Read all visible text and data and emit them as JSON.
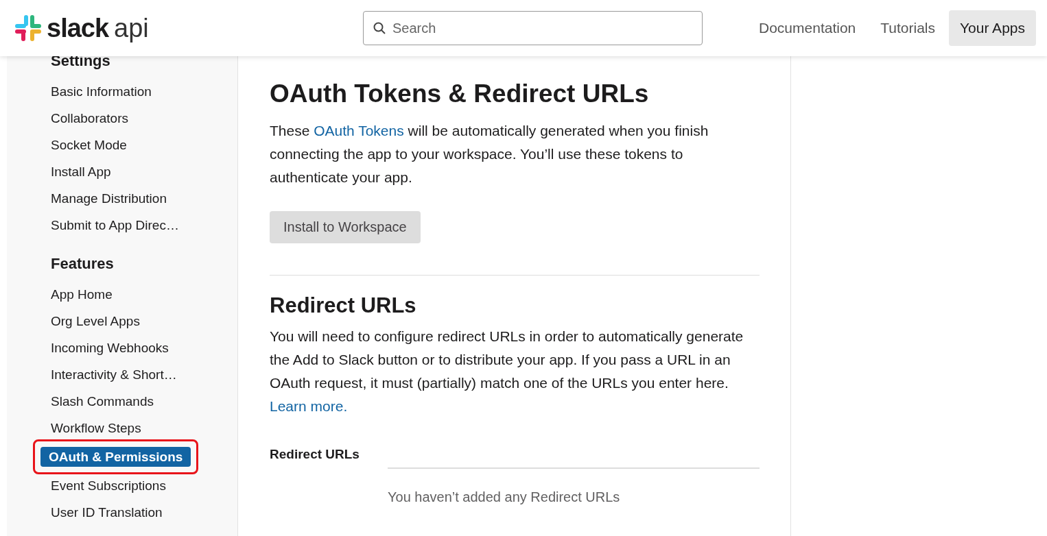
{
  "header": {
    "logo": {
      "word": "slack",
      "suffix": "api"
    },
    "search": {
      "placeholder": "Search"
    },
    "nav": [
      {
        "label": "Documentation",
        "selected": false
      },
      {
        "label": "Tutorials",
        "selected": false
      },
      {
        "label": "Your Apps",
        "selected": true
      }
    ]
  },
  "sidebar": {
    "sections": [
      {
        "title": "Settings",
        "items": [
          {
            "label": "Basic Information",
            "selected": false
          },
          {
            "label": "Collaborators",
            "selected": false
          },
          {
            "label": "Socket Mode",
            "selected": false
          },
          {
            "label": "Install App",
            "selected": false
          },
          {
            "label": "Manage Distribution",
            "selected": false
          },
          {
            "label": "Submit to App Direc…",
            "selected": false
          }
        ]
      },
      {
        "title": "Features",
        "items": [
          {
            "label": "App Home",
            "selected": false
          },
          {
            "label": "Org Level Apps",
            "selected": false
          },
          {
            "label": "Incoming Webhooks",
            "selected": false
          },
          {
            "label": "Interactivity & Short…",
            "selected": false
          },
          {
            "label": "Slash Commands",
            "selected": false
          },
          {
            "label": "Workflow Steps",
            "selected": false
          },
          {
            "label": "OAuth & Permissions",
            "selected": true,
            "highlighted": true
          },
          {
            "label": "Event Subscriptions",
            "selected": false
          },
          {
            "label": "User ID Translation",
            "selected": false
          }
        ]
      }
    ]
  },
  "main": {
    "title": "OAuth Tokens & Redirect URLs",
    "intro": {
      "before": "These ",
      "link": "OAuth Tokens",
      "after": " will be automatically generated when you finish connecting the app to your workspace. You’ll use these tokens to authenticate your app."
    },
    "install_button": "Install to Workspace",
    "redirect": {
      "title": "Redirect URLs",
      "text": "You will need to configure redirect URLs in order to automatically generate the Add to Slack button or to distribute your app. If you pass a URL in an OAuth request, it must (partially) match one of the URLs you enter here.",
      "link": "Learn more.",
      "label": "Redirect URLs",
      "empty": "You haven’t added any Redirect URLs"
    }
  }
}
